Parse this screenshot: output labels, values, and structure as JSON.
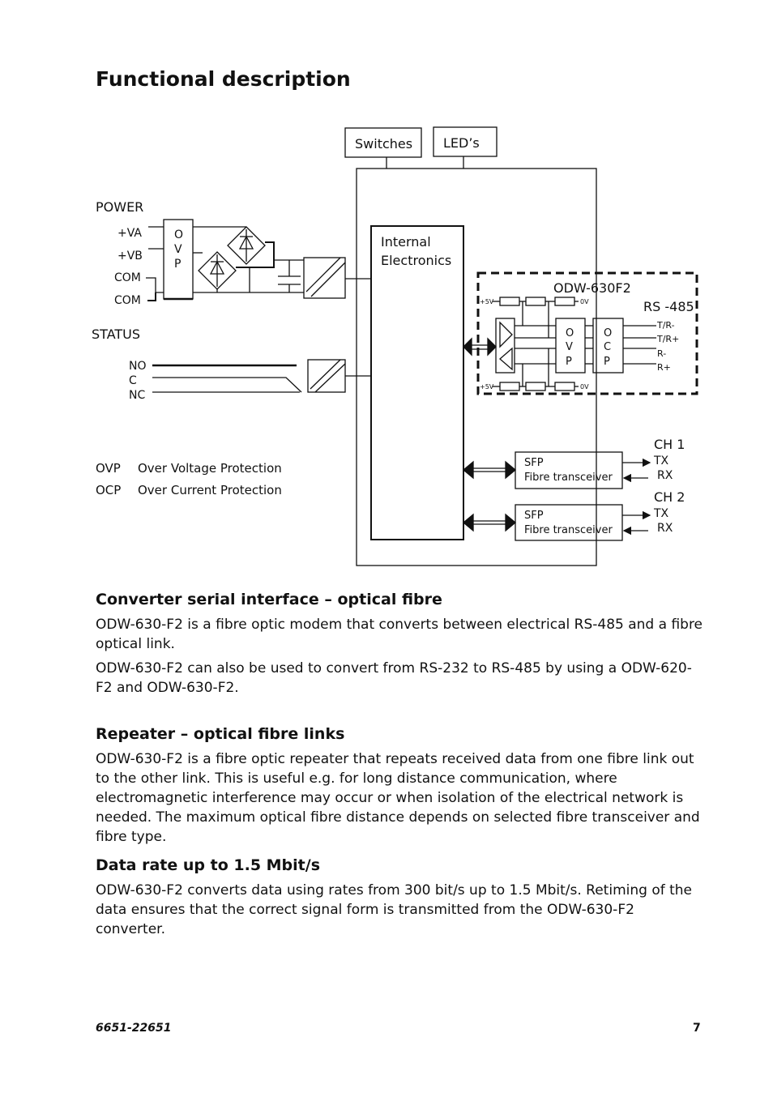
{
  "page": {
    "title": "Functional description",
    "footer_doc_number": "6651-22651",
    "page_number": "7"
  },
  "diagram": {
    "switches_label": "Switches",
    "leds_label": "LED’s",
    "power_label": "POWER",
    "power_pins": [
      "+VA",
      "+VB",
      "COM",
      "COM"
    ],
    "ovp_letters": [
      "O",
      "V",
      "P"
    ],
    "ocp_letters": [
      "O",
      "C",
      "P"
    ],
    "status_label": "STATUS",
    "status_pins": [
      "NO",
      "C",
      "NC"
    ],
    "internal_line1": "Internal",
    "internal_line2": "Electronics",
    "rs485_module": "ODW-630F2",
    "rs485_label": "RS -485",
    "rs485_pins": [
      "T/R-",
      "T/R+",
      "R-",
      "R+"
    ],
    "supply_plus": "+5V",
    "supply_zero": "0V",
    "sfp_line1": "SFP",
    "sfp_line2": "Fibre transceiver",
    "ch1_label": "CH 1",
    "ch2_label": "CH 2",
    "tx_label": "TX",
    "rx_label": "RX",
    "legend": [
      {
        "abbr": "OVP",
        "text": "Over Voltage Protection"
      },
      {
        "abbr": "OCP",
        "text": "Over Current Protection"
      }
    ]
  },
  "sections": [
    {
      "heading": "Converter serial interface – optical fibre",
      "paragraphs": [
        "ODW-630-F2 is a fibre optic modem that converts between electrical RS-485 and a fibre optical link.",
        "ODW-630-F2 can also be used to convert from RS-232 to RS-485 by using a ODW-620-F2 and ODW-630-F2."
      ]
    },
    {
      "heading": "Repeater – optical fibre links",
      "paragraphs": [
        "ODW-630-F2 is a fibre optic repeater that repeats received data from one fibre link out to the other link. This is useful e.g. for long distance communication, where electromagnetic interference may occur or when isolation of the electrical network is needed. The maximum optical fibre distance depends on selected fibre transceiver and fibre type."
      ]
    },
    {
      "heading": "Data rate up to 1.5 Mbit/s",
      "paragraphs": [
        "ODW-630-F2 converts data using rates from 300 bit/s up to 1.5 Mbit/s. Retiming of the data ensures that the correct signal form is transmitted from the ODW-630-F2 converter."
      ]
    }
  ]
}
